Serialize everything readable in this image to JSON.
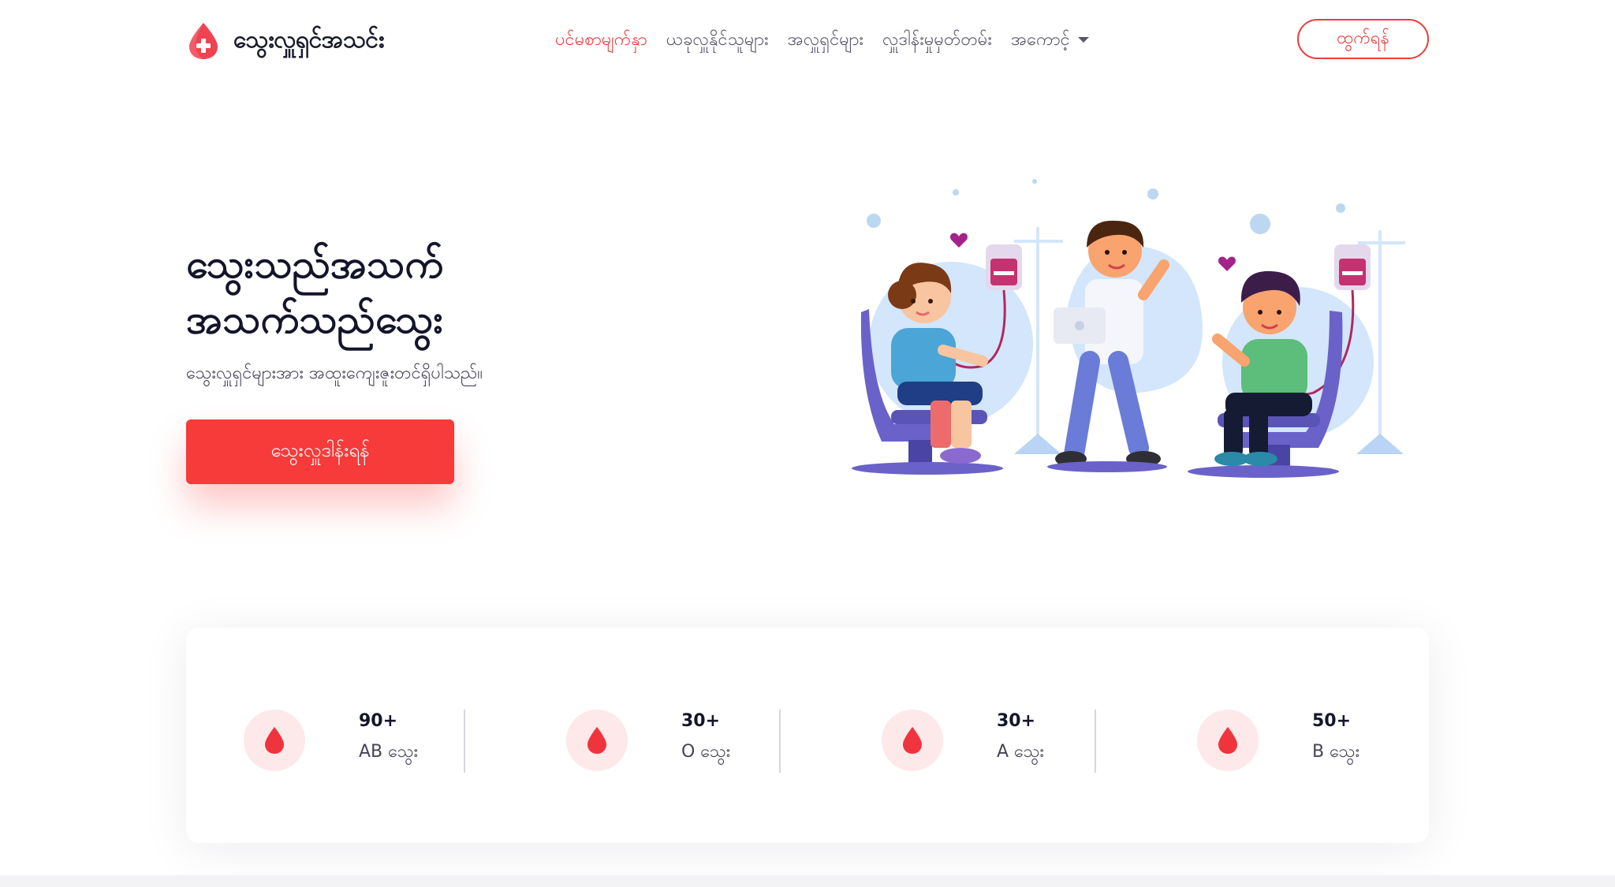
{
  "brand": {
    "name": "သွေးလှူရှင်အသင်း"
  },
  "nav": {
    "links": [
      {
        "label": "ပင်မစာမျက်နှာ",
        "active": true
      },
      {
        "label": "ယခုလှူနိုင်သူများ"
      },
      {
        "label": "အလှူရှင်များ"
      },
      {
        "label": "လှူဒါန်းမှုမှတ်တမ်း"
      },
      {
        "label": "အကောင့်"
      }
    ],
    "logout_label": "ထွက်ရန်"
  },
  "hero": {
    "title_line1": "သွေးသည်အသက်",
    "title_line2": "အသက်သည်သွေး",
    "subtitle": "သွေးလှူရှင်များအား အထူးကျေးဇူးတင်ရှိပါသည်။",
    "cta_label": "သွေးလှူဒါန်းရန်"
  },
  "stats": [
    {
      "value": "90+",
      "label": "AB သွေး"
    },
    {
      "value": "30+",
      "label": "O သွေး"
    },
    {
      "value": "30+",
      "label": "A သွေး"
    },
    {
      "value": "50+",
      "label": "B သွေး"
    }
  ],
  "colors": {
    "accent": "#f73a3a",
    "icon_bg": "#fde9ea",
    "text_dark": "#14152a"
  }
}
